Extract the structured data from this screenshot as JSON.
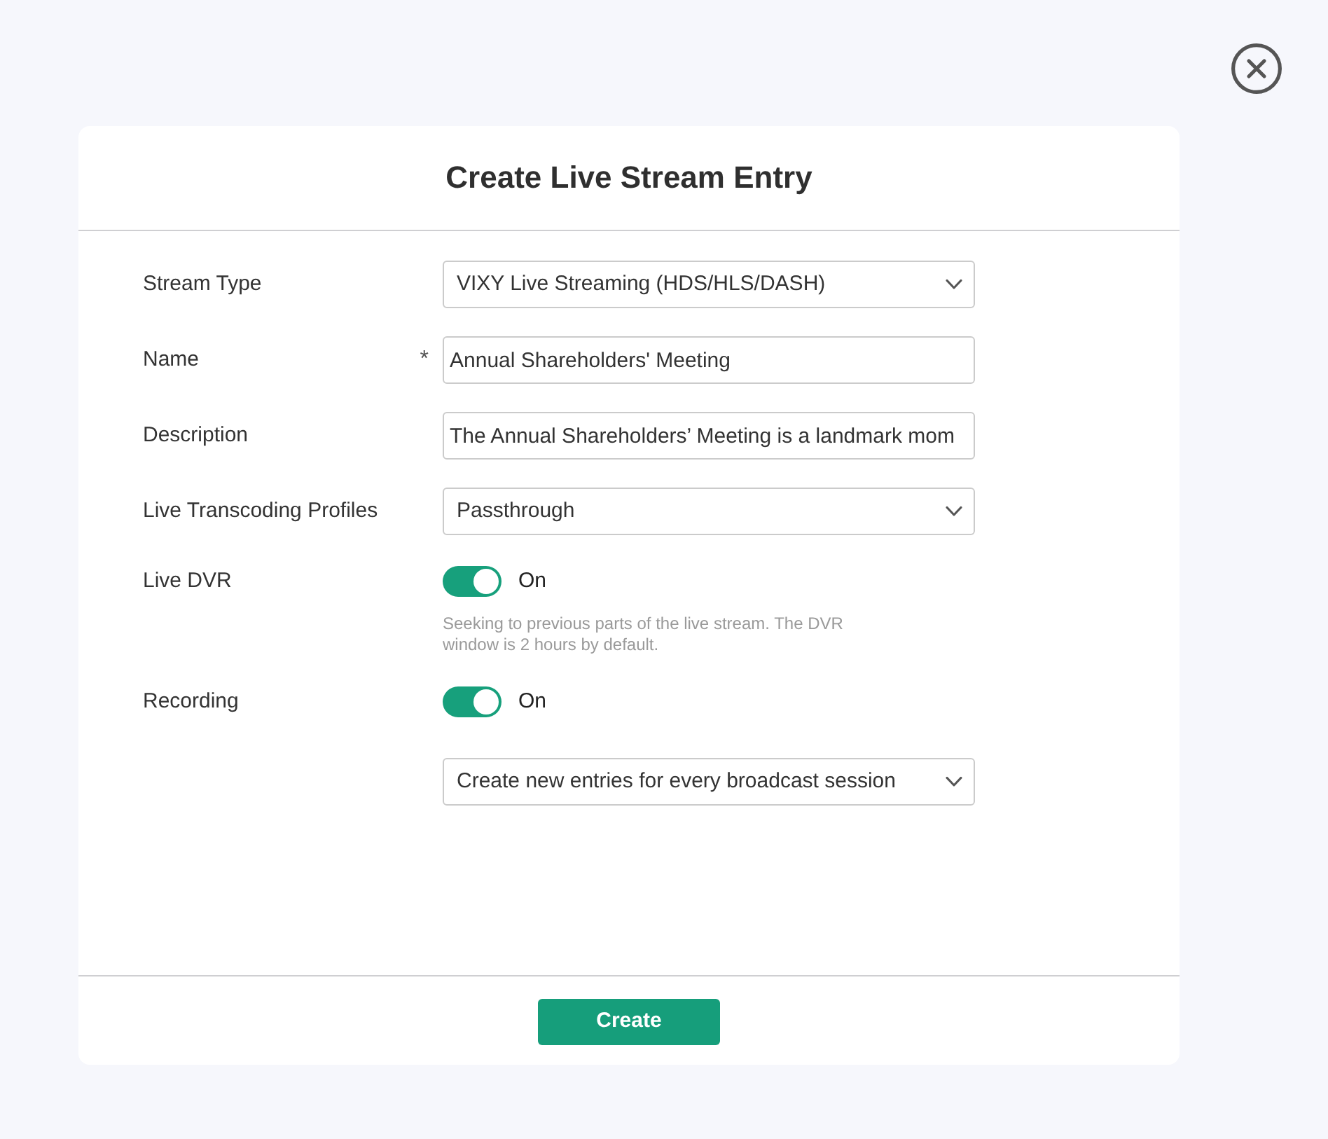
{
  "dialog": {
    "title": "Create Live Stream Entry"
  },
  "fields": [
    {
      "kind": "select",
      "label": "Stream Type",
      "value": "VIXY Live Streaming (HDS/HLS/DASH)"
    },
    {
      "kind": "text",
      "label": "Name",
      "required_mark": "*",
      "value": "Annual Shareholders' Meeting"
    },
    {
      "kind": "text",
      "label": "Description",
      "value": "The Annual Shareholders’ Meeting is a landmark mom"
    },
    {
      "kind": "select",
      "label": "Live Transcoding Profiles",
      "value": "Passthrough"
    },
    {
      "kind": "toggle",
      "label": "Live DVR",
      "on": true,
      "state_text": "On",
      "help": "Seeking to previous parts of the live stream. The DVR window is 2 hours by default."
    },
    {
      "kind": "toggle",
      "label": "Recording",
      "on": true,
      "state_text": "On"
    },
    {
      "kind": "select",
      "value": "Create new entries for every broadcast session"
    }
  ],
  "buttons": [
    {
      "label": "Create"
    }
  ]
}
